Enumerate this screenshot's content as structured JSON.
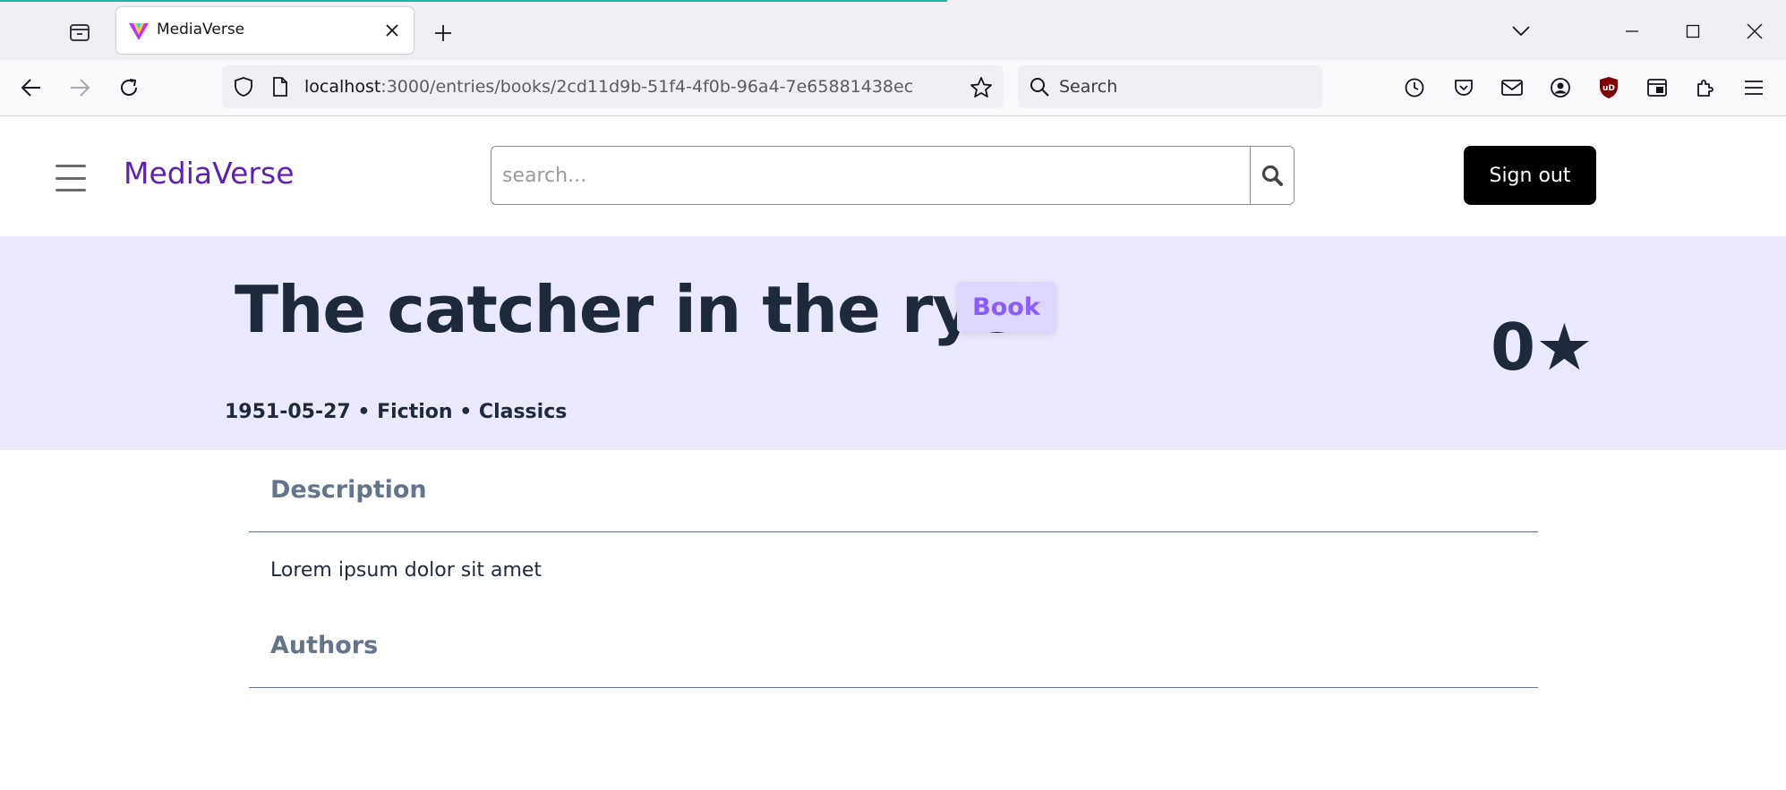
{
  "browser": {
    "tab_title": "MediaVerse",
    "url_host": "localhost",
    "url_path": ":3000/entries/books/2cd11d9b-51f4-4f0b-96a4-7e65881438ec",
    "search_placeholder": "Search",
    "icons": {
      "tab_overview": "tab-overview-icon",
      "favicon": "mediaverse-logo-icon",
      "tab_close": "close-icon",
      "new_tab": "plus-icon",
      "list_tabs": "chevron-down-icon",
      "minimize": "minimize-icon",
      "maximize": "maximize-icon",
      "window_close": "close-icon",
      "back": "arrow-left-icon",
      "forward": "arrow-right-icon",
      "reload": "reload-icon",
      "shield": "shield-icon",
      "page_info": "page-icon",
      "bookmark": "star-icon",
      "search": "search-icon",
      "history": "history-icon",
      "pocket": "pocket-icon",
      "mail": "mail-icon",
      "account": "account-icon",
      "ublock": "ublock-icon",
      "container": "container-icon",
      "extensions": "puzzle-icon",
      "menu": "menu-icon"
    }
  },
  "header": {
    "brand": "MediaVerse",
    "search_placeholder": "search...",
    "signout_label": "Sign out"
  },
  "entry": {
    "title": "The catcher in the rye",
    "type": "Book",
    "rating": "0★",
    "meta": "1951-05-27 • Fiction • Classics",
    "description_heading": "Description",
    "description": "Lorem ipsum dolor sit amet",
    "authors_heading": "Authors"
  },
  "colors": {
    "brand": "#5b21b6",
    "hero_bg": "#ebe9fe",
    "badge_bg": "#ddd6fe",
    "badge_text": "#8b5cf6",
    "heading_text": "#1e2a3b",
    "section_heading": "#64748b",
    "signout_bg": "#000000"
  }
}
